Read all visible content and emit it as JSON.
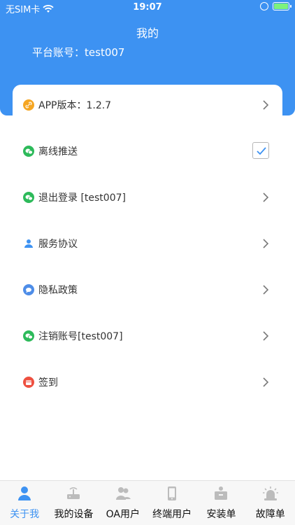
{
  "status_bar": {
    "carrier": "无SIM卡",
    "time": "19:07"
  },
  "header": {
    "title": "我的",
    "account_label": "平台账号：",
    "account_value": "test007"
  },
  "version": {
    "label": "APP版本：",
    "value": "1.2.7",
    "icon": "link-icon",
    "color": "#f5a623"
  },
  "menu": [
    {
      "label": "离线推送",
      "icon": "wechat-icon",
      "color": "#2dba5a",
      "control": "checkbox",
      "checked": true
    },
    {
      "label": "退出登录 [test007]",
      "icon": "wechat-icon",
      "color": "#2dba5a",
      "control": "chevron"
    },
    {
      "label": "服务协议",
      "icon": "user-icon",
      "color": "#3d92f2",
      "control": "chevron"
    },
    {
      "label": "隐私政策",
      "icon": "chat-bubble-icon",
      "color": "#4e8de8",
      "control": "chevron"
    },
    {
      "label": "注销账号[test007]",
      "icon": "wechat-icon",
      "color": "#2dba5a",
      "control": "chevron"
    },
    {
      "label": "签到",
      "icon": "calendar-icon",
      "color": "#ee5040",
      "control": "chevron"
    }
  ],
  "tabs": [
    {
      "label": "关于我",
      "icon": "person-icon",
      "active": true
    },
    {
      "label": "我的设备",
      "icon": "router-icon",
      "active": false
    },
    {
      "label": "OA用户",
      "icon": "users-icon",
      "active": false
    },
    {
      "label": "终端用户",
      "icon": "phone-icon",
      "active": false
    },
    {
      "label": "安装单",
      "icon": "install-box-icon",
      "active": false
    },
    {
      "label": "故障单",
      "icon": "alarm-icon",
      "active": false
    }
  ],
  "colors": {
    "brand": "#3d92f2",
    "tab_inactive": "#bcbcbc"
  }
}
